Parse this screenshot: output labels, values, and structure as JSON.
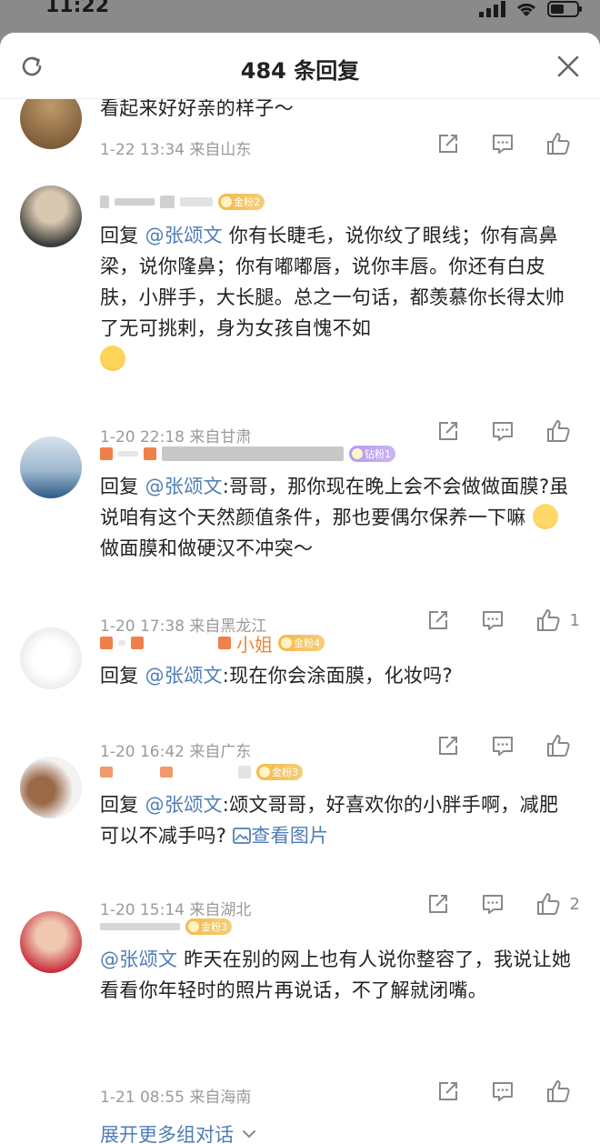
{
  "status": {
    "time": "11:22"
  },
  "header": {
    "title": "484 条回复"
  },
  "comments": [
    {
      "text": "看起来好好亲的样子～",
      "time": "1-22 13:34",
      "location": "来自山东",
      "likes": ""
    },
    {
      "badge": "金粉2",
      "reply_prefix": "回复",
      "mention": "@张颂文",
      "text": " 你有长睫毛，说你纹了眼线；你有高鼻梁，说你隆鼻；你有嘟嘟唇，说你丰唇。你还有白皮肤，小胖手，大长腿。总之一句话，都羡慕你长得太帅了无可挑剌，身为女孩自愧不如",
      "time": "1-20 22:18",
      "location": "来自甘肃",
      "likes": ""
    },
    {
      "badge": "钻粉1",
      "reply_prefix": "回复",
      "mention": "@张颂文",
      "text": ":哥哥，那你现在晚上会不会做做面膜?虽说咱有这个天然颜值条件，那也要偶尔保养一下嘛",
      "text2": " 做面膜和做硬汉不冲突～",
      "time": "1-20 17:38",
      "location": "来自黑龙江",
      "likes": "1"
    },
    {
      "name_tail": "小姐",
      "badge": "金粉4",
      "reply_prefix": "回复",
      "mention": "@张颂文",
      "text": ":现在你会涂面膜，化妆吗?",
      "time": "1-20 16:42",
      "location": "来自广东",
      "likes": ""
    },
    {
      "badge": "金粉3",
      "reply_prefix": "回复",
      "mention": "@张颂文",
      "text": ":颂文哥哥，好喜欢你的小胖手啊，减肥可以不减手吗?",
      "link_text": "查看图片",
      "time": "1-20 15:14",
      "location": "来自湖北",
      "likes": "2"
    },
    {
      "badge": "金粉3",
      "mention": "@张颂文",
      "text": " 昨天在别的网上也有人说你整容了，我说让她看看你年轻时的照片再说话，不了解就闭嘴。",
      "time": "1-21 08:55",
      "location": "来自海南",
      "likes": "",
      "expand": "展开更多组对话"
    }
  ]
}
